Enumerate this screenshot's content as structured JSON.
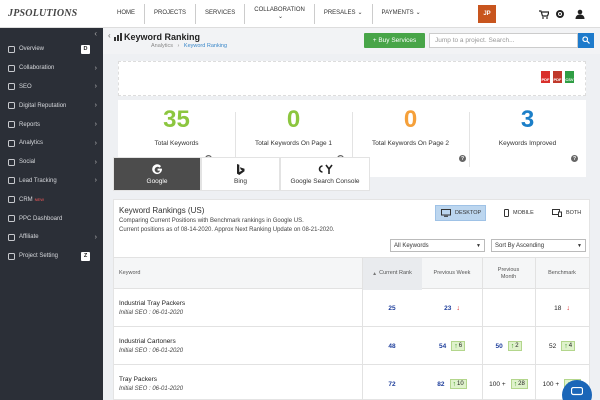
{
  "brand": {
    "logo_text": "JPSOLUTIONS"
  },
  "nav": {
    "items": [
      {
        "label": "HOME",
        "caret": ""
      },
      {
        "label": "PROJECTS",
        "caret": ""
      },
      {
        "label": "SERVICES",
        "caret": ""
      },
      {
        "label": "COLLABORATION",
        "caret": "⌄"
      },
      {
        "label": "PRESALES",
        "caret": "⌄"
      },
      {
        "label": "PAYMENTS",
        "caret": "⌄"
      }
    ],
    "avatar_initials": "JP"
  },
  "sidebar": {
    "items": [
      {
        "label": "Overview",
        "icon": "grid-icon",
        "badge": "D",
        "chevron": "",
        "new": ""
      },
      {
        "label": "Collaboration",
        "icon": "people-icon",
        "badge": "",
        "chevron": "›",
        "new": ""
      },
      {
        "label": "SEO",
        "icon": "seo-icon",
        "badge": "",
        "chevron": "›",
        "new": ""
      },
      {
        "label": "Digital Reputation",
        "icon": "star-icon",
        "badge": "",
        "chevron": "›",
        "new": ""
      },
      {
        "label": "Reports",
        "icon": "report-icon",
        "badge": "",
        "chevron": "›",
        "new": ""
      },
      {
        "label": "Analytics",
        "icon": "analytics-icon",
        "badge": "",
        "chevron": "›",
        "new": ""
      },
      {
        "label": "Social",
        "icon": "social-icon",
        "badge": "",
        "chevron": "›",
        "new": ""
      },
      {
        "label": "Lead Tracking",
        "icon": "lead-icon",
        "badge": "",
        "chevron": "›",
        "new": ""
      },
      {
        "label": "CRM",
        "icon": "crm-icon",
        "badge": "",
        "chevron": "",
        "new": "NEW"
      },
      {
        "label": "PPC Dashboard",
        "icon": "ppc-icon",
        "badge": "",
        "chevron": "",
        "new": ""
      },
      {
        "label": "Affiliate",
        "icon": "affiliate-icon",
        "badge": "",
        "chevron": "›",
        "new": ""
      },
      {
        "label": "Project Setting",
        "icon": "setting-icon",
        "badge": "Z",
        "chevron": "",
        "new": ""
      }
    ]
  },
  "header": {
    "back_arrow": "‹",
    "title": "Keyword Ranking",
    "breadcrumb": {
      "parent": "Analytics",
      "sep": "›",
      "current": "Keyword Ranking"
    },
    "buy_button": "+ Buy Services",
    "search_placeholder": "Jump to a project. Search..."
  },
  "exports": [
    {
      "name": "pdf",
      "label": "PDF",
      "color": "#d9302c"
    },
    {
      "name": "pdf-alt",
      "label": "PDF",
      "color": "#c0392b"
    },
    {
      "name": "excel",
      "label": "CSV",
      "color": "#2f9e44"
    }
  ],
  "stats": [
    {
      "value": "35",
      "label": "Total Keywords",
      "color": "#8cc63f"
    },
    {
      "value": "0",
      "label": "Total Keywords On Page 1",
      "color": "#8cc63f"
    },
    {
      "value": "0",
      "label": "Total Keywords On Page 2",
      "color": "#f5a03a"
    },
    {
      "value": "3",
      "label": "Keywords Improved",
      "color": "#1c7fc8"
    }
  ],
  "engines": [
    {
      "label": "Google",
      "active": true
    },
    {
      "label": "Bing",
      "active": false
    },
    {
      "label": "Google Search Console",
      "active": false
    }
  ],
  "panel": {
    "title": "Keyword Rankings (US)",
    "subtitle_1": "Comparing Current Positions with Benchmark rankings in Google US.",
    "subtitle_2": "Current positions as of 08-14-2020. Approx Next Ranking Update on 08-21-2020.",
    "devices": [
      {
        "label": "DESKTOP",
        "active": true
      },
      {
        "label": "MOBILE",
        "active": false
      },
      {
        "label": "BOTH",
        "active": false
      }
    ],
    "filter_select": "All Keywords",
    "sort_select": "Sort By Ascending"
  },
  "table": {
    "headers": {
      "keyword": "Keyword",
      "current_rank": "Current Rank",
      "sort_arrow": "▲",
      "previous_week": "Previous Week",
      "previous_month_1": "Previous",
      "previous_month_2": "Month",
      "benchmark": "Benchmark"
    },
    "rows": [
      {
        "keyword": "Industrial Tray Packers",
        "sub": "Initial SEO : 06-01-2020",
        "current": "25",
        "prev_week": "23",
        "prev_week_dir": "down",
        "prev_week_change": "",
        "prev_month": "",
        "prev_month_dir": "",
        "prev_month_change": "",
        "benchmark": "18",
        "benchmark_dir": "down",
        "benchmark_change": ""
      },
      {
        "keyword": "Industrial Cartoners",
        "sub": "Initial SEO : 06-01-2020",
        "current": "48",
        "prev_week": "54",
        "prev_week_dir": "up",
        "prev_week_change": "6",
        "prev_month": "50",
        "prev_month_dir": "up",
        "prev_month_change": "2",
        "benchmark": "52",
        "benchmark_dir": "up",
        "benchmark_change": "4"
      },
      {
        "keyword": "Tray Packers",
        "sub": "Initial SEO : 06-01-2020",
        "current": "72",
        "prev_week": "82",
        "prev_week_dir": "up",
        "prev_week_change": "10",
        "prev_month": "100 +",
        "prev_month_dir": "up",
        "prev_month_change": "28",
        "benchmark": "100 +",
        "benchmark_dir": "up",
        "benchmark_change": "28"
      }
    ]
  }
}
